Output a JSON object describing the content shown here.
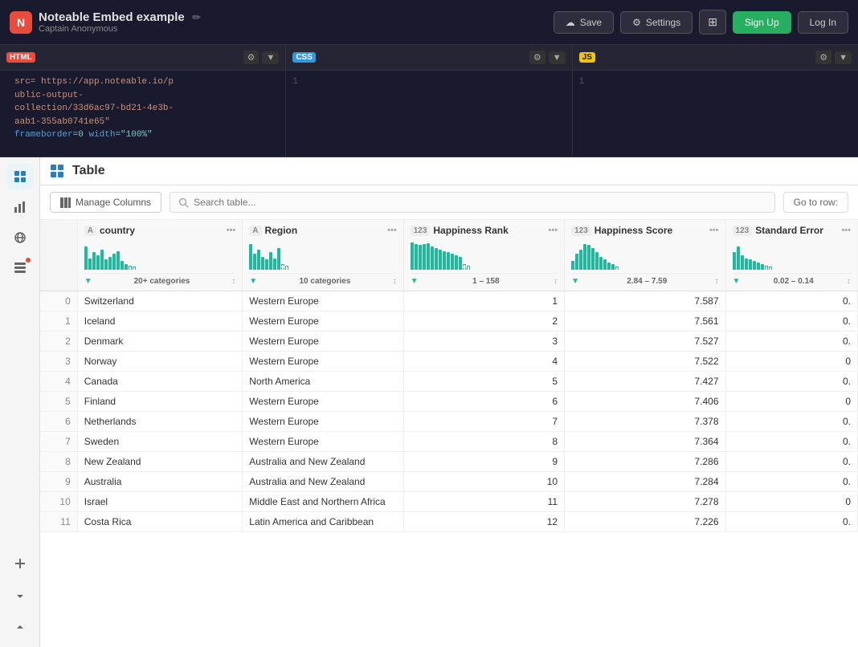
{
  "topbar": {
    "logo_letter": "N",
    "title": "Noteable Embed example",
    "pencil": "✏",
    "subtitle": "Captain Anonymous",
    "buttons": {
      "save": "Save",
      "settings": "Settings",
      "layout": "⊞",
      "signup": "Sign Up",
      "login": "Log In"
    }
  },
  "editors": [
    {
      "id": "html",
      "badge": "HTML",
      "badge_type": "html",
      "line_num": "",
      "code": "src= https://app.noteable.io/p\nublic-output-\ncollection/33d6ac97-bd21-4e3b-\naab1-355ab0741e65\"\nframeborder=0 width=\"100%\""
    },
    {
      "id": "css",
      "badge": "CSS",
      "badge_type": "css",
      "line_num": "1",
      "code": ""
    },
    {
      "id": "js",
      "badge": "JS",
      "badge_type": "js",
      "line_num": "1",
      "code": ""
    }
  ],
  "table": {
    "title": "Table",
    "manage_columns_label": "Manage Columns",
    "search_placeholder": "Search table...",
    "goto_row_label": "Go to row:",
    "columns": [
      {
        "id": "country",
        "type": "A",
        "name": "country",
        "filter_label": "20+ categories",
        "range": ""
      },
      {
        "id": "region",
        "type": "A",
        "name": "Region",
        "filter_label": "10 categories",
        "range": ""
      },
      {
        "id": "happiness_rank",
        "type": "123",
        "name": "Happiness Rank",
        "filter_label": "1 – 158",
        "range": ""
      },
      {
        "id": "happiness_score",
        "type": "123",
        "name": "Happiness Score",
        "filter_label": "2.84 – 7.59",
        "range": ""
      },
      {
        "id": "standard_error",
        "type": "123",
        "name": "Standard Error",
        "filter_label": "0.02 – 0.14",
        "range": ""
      }
    ],
    "rows": [
      {
        "idx": 0,
        "country": "Switzerland",
        "region": "Western Europe",
        "rank": 1,
        "score": 7.587,
        "error": "0."
      },
      {
        "idx": 1,
        "country": "Iceland",
        "region": "Western Europe",
        "rank": 2,
        "score": 7.561,
        "error": "0."
      },
      {
        "idx": 2,
        "country": "Denmark",
        "region": "Western Europe",
        "rank": 3,
        "score": 7.527,
        "error": "0."
      },
      {
        "idx": 3,
        "country": "Norway",
        "region": "Western Europe",
        "rank": 4,
        "score": 7.522,
        "error": "0"
      },
      {
        "idx": 4,
        "country": "Canada",
        "region": "North America",
        "rank": 5,
        "score": 7.427,
        "error": "0."
      },
      {
        "idx": 5,
        "country": "Finland",
        "region": "Western Europe",
        "rank": 6,
        "score": 7.406,
        "error": "0"
      },
      {
        "idx": 6,
        "country": "Netherlands",
        "region": "Western Europe",
        "rank": 7,
        "score": 7.378,
        "error": "0."
      },
      {
        "idx": 7,
        "country": "Sweden",
        "region": "Western Europe",
        "rank": 8,
        "score": 7.364,
        "error": "0."
      },
      {
        "idx": 8,
        "country": "New Zealand",
        "region": "Australia and New Zealand",
        "rank": 9,
        "score": 7.286,
        "error": "0."
      },
      {
        "idx": 9,
        "country": "Australia",
        "region": "Australia and New Zealand",
        "rank": 10,
        "score": 7.284,
        "error": "0."
      },
      {
        "idx": 10,
        "country": "Israel",
        "region": "Middle East and Northern Africa",
        "rank": 11,
        "score": 7.278,
        "error": "0"
      },
      {
        "idx": 11,
        "country": "Costa Rica",
        "region": "Latin America and Caribbean",
        "rank": 12,
        "score": 7.226,
        "error": "0."
      }
    ]
  },
  "sidebar_icons": [
    "table-icon",
    "chart-icon",
    "globe-icon",
    "data-icon",
    "plus-icon"
  ]
}
